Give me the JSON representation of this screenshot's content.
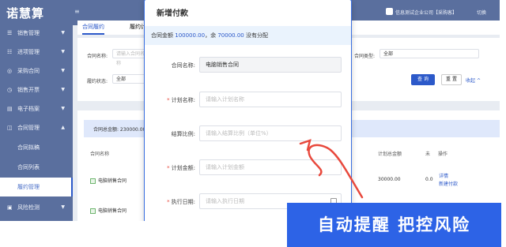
{
  "app": {
    "logo": "诺慧算",
    "company": "信息测试企业公司【采购客】",
    "switch_label": "切换"
  },
  "sidebar": {
    "items": [
      {
        "icon": "☰",
        "label": "销售管理"
      },
      {
        "icon": "☷",
        "label": "进项管理"
      },
      {
        "icon": "◎",
        "label": "采购合同"
      },
      {
        "icon": "◷",
        "label": "销售开票"
      },
      {
        "icon": "▤",
        "label": "电子档案"
      },
      {
        "icon": "◫",
        "label": "合同管理"
      }
    ],
    "sub_items": [
      {
        "label": "合同拟稿"
      },
      {
        "label": "合同列表"
      },
      {
        "label": "履约管理"
      }
    ],
    "bottom_item": {
      "icon": "▣",
      "label": "风险检测"
    }
  },
  "tabs": [
    "合同履约",
    "履约计"
  ],
  "filters": {
    "contract_name_label": "合同名称:",
    "contract_name_placeholder": "请输入合同名称",
    "contract_type_label": "合同类型:",
    "contract_type_value": "全部",
    "status_label": "履约状态:",
    "status_value": "全部",
    "query_button": "查 询",
    "reset_button": "重 置",
    "collapse_link": "收起"
  },
  "table": {
    "summary": "合同总金额: 230000.00",
    "headers": [
      "合同名称",
      "计划总金额",
      "未",
      "操作"
    ],
    "rows": [
      {
        "name": "电脑销售合同",
        "amount": "30000.00",
        "rest": "0.0",
        "actions": [
          "详情",
          "新建付款"
        ]
      },
      {
        "name": "电脑销售合同",
        "amount": "",
        "rest": "",
        "actions": []
      }
    ]
  },
  "modal": {
    "title": "新增付款",
    "info_prefix": "合同金额",
    "info_total": "100000.00",
    "info_mid": "，余",
    "info_rest": "70000.00",
    "info_suffix": "没有分配",
    "fields": [
      {
        "label": "合同名称:",
        "required": false,
        "value": "电脑销售合同",
        "placeholder": ""
      },
      {
        "label": "计划名称:",
        "required": true,
        "value": "",
        "placeholder": "请输入计划名称"
      },
      {
        "label": "结算比例:",
        "required": false,
        "value": "",
        "placeholder": "请输入结算比例（单位%）"
      },
      {
        "label": "计划金额:",
        "required": true,
        "value": "",
        "placeholder": "请输入计划金额"
      },
      {
        "label": "执行日期:",
        "required": true,
        "value": "",
        "placeholder": "请输入执行日期"
      }
    ]
  },
  "promo": {
    "text": "自动提醒 把控风险"
  },
  "colors": {
    "primary": "#2c59c9",
    "sidebar": "#5a6f9e",
    "promo": "#2d63e6",
    "arrow": "#e8483c"
  }
}
